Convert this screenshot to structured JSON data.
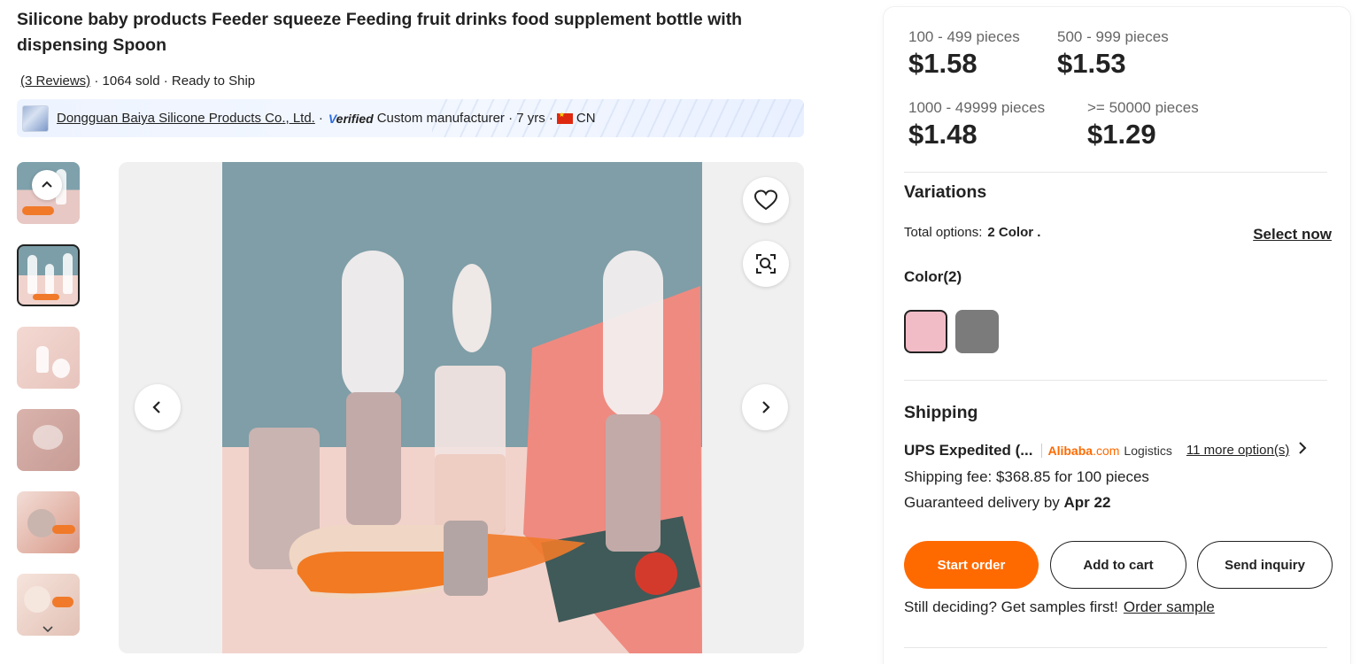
{
  "product": {
    "title": "Silicone baby products Feeder squeeze Feeding fruit drinks food supplement bottle with dispensing Spoon",
    "reviews": "(3 Reviews)",
    "sold": " · 1064 sold · Ready to Ship"
  },
  "supplier": {
    "name": "Dongguan Baiya Silicone Products Co., Ltd.",
    "dot": " ·",
    "verified_v": "V",
    "verified_rest": "erified",
    "type": "Custom manufacturer · 7 yrs ·",
    "country": "CN"
  },
  "pricing": {
    "tiers": [
      {
        "qty": "100 - 499 pieces",
        "price": "$1.58"
      },
      {
        "qty": "500 - 999 pieces",
        "price": "$1.53"
      },
      {
        "qty": "1000 - 49999 pieces",
        "price": "$1.48"
      },
      {
        "qty": ">= 50000 pieces",
        "price": "$1.29"
      }
    ]
  },
  "variations": {
    "title": "Variations",
    "total_label": "Total options:",
    "total_value": "2 Color .",
    "select_now": "Select now",
    "color_title": "Color(2)",
    "swatches": [
      "#f1bcc6",
      "#7b7b7b"
    ]
  },
  "shipping": {
    "title": "Shipping",
    "method": "UPS Expedited (...",
    "brand": "Alibaba",
    "brand_suffix": ".com",
    "logistics": "Logistics",
    "more_options": "11 more option(s)",
    "fee": "Shipping fee: $368.85 for 100 pieces",
    "delivery_label": "Guaranteed delivery by ",
    "delivery_date": "Apr 22"
  },
  "actions": {
    "start_order": "Start order",
    "add_to_cart": "Add to cart",
    "send_inquiry": "Send inquiry",
    "samples_text": "Still deciding? Get samples first!",
    "order_sample": "Order sample"
  },
  "colors": {
    "accent": "#ff6a00",
    "verified_blue": "#2d6cdf",
    "swatch_pink": "#f1bcc6",
    "swatch_gray": "#7b7b7b"
  },
  "icons": [
    "chevron-up-icon",
    "chevron-down-icon",
    "chevron-left-icon",
    "chevron-right-icon",
    "heart-icon",
    "image-search-icon",
    "flag-cn-icon"
  ]
}
